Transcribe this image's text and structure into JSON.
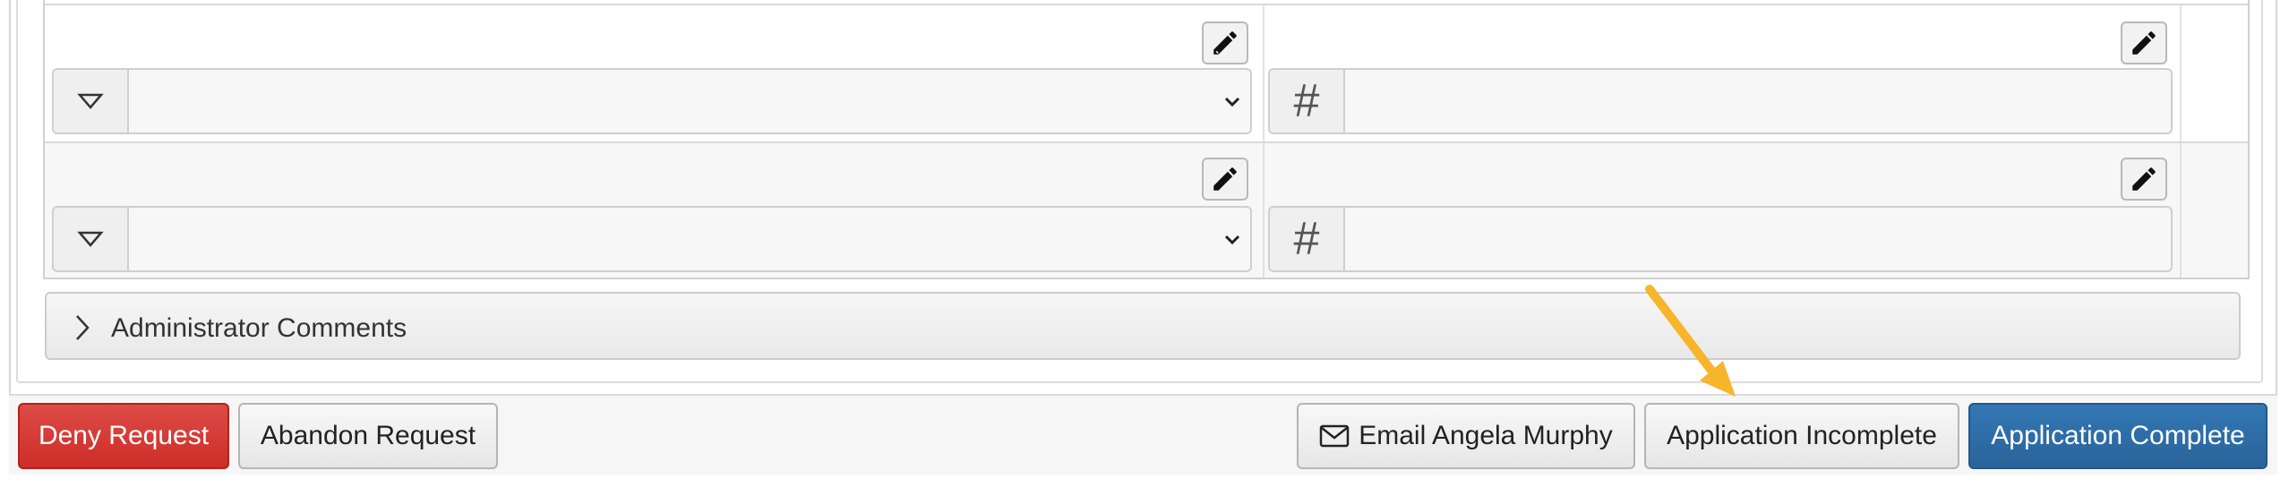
{
  "grid": {
    "rows": [
      {
        "left_select": {
          "value": ""
        },
        "right_input": {
          "value": ""
        }
      },
      {
        "left_select": {
          "value": ""
        },
        "right_input": {
          "value": ""
        }
      }
    ],
    "number_addon_symbol": "#"
  },
  "accordion": {
    "label": "Administrator Comments"
  },
  "footer": {
    "deny_label": "Deny Request",
    "abandon_label": "Abandon Request",
    "email_label": "Email Angela Murphy",
    "incomplete_label": "Application Incomplete",
    "complete_label": "Application Complete"
  },
  "colors": {
    "danger": "#d9534f",
    "primary": "#2e6da4",
    "annotation_arrow": "#f7b52c"
  },
  "icons": {
    "edit": "pencil-icon",
    "select_addon": "triangle-down-icon",
    "select_caret": "chevron-down-icon",
    "number_addon": "hash-icon",
    "accordion": "chevron-right-icon",
    "email": "envelope-icon",
    "annotation": "arrow-annotation-icon"
  }
}
